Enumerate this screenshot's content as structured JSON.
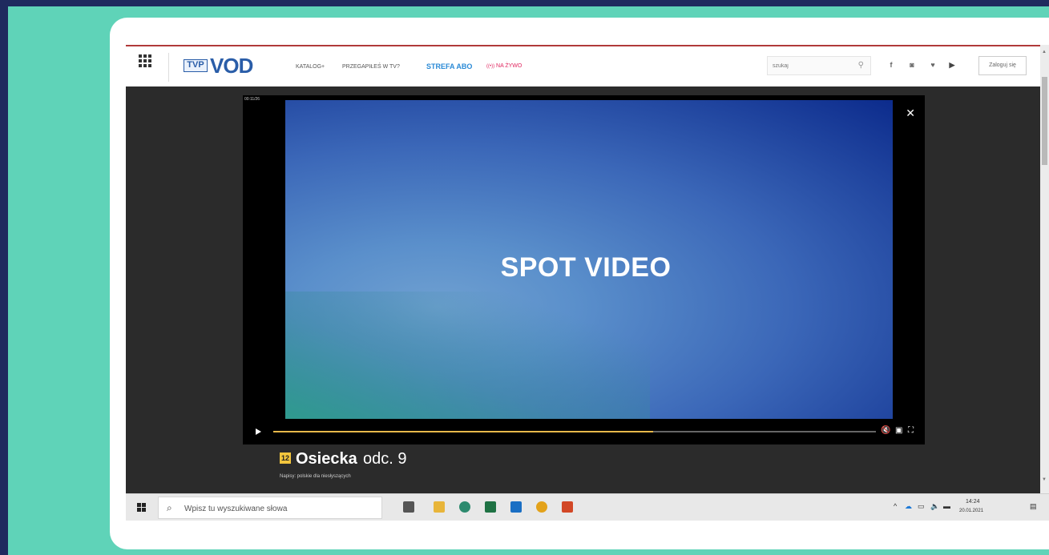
{
  "colors": {
    "background": "#1f2a5e",
    "frame": "#5fd3b8",
    "accent_blue": "#2a5da8",
    "live_red": "#e0245e",
    "progress": "#e6b84a"
  },
  "header": {
    "logo_tvp": "TVP",
    "logo_vod": "VOD",
    "nav": {
      "katalog": "KATALOG+",
      "przegapiles": "PRZEGAPIŁEŚ W TV?",
      "strefa": "STREFA ABO",
      "live": "NA ŻYWO"
    },
    "search_placeholder": "szukaj",
    "login_label": "Zaloguj się",
    "social_icons": [
      "facebook-icon",
      "instagram-icon",
      "twitter-icon",
      "youtube-icon"
    ]
  },
  "player": {
    "ad_timer": "00:11/26",
    "title": "SPOT VIDEO",
    "progress": 0.63
  },
  "show": {
    "age_rating": "12",
    "title": "Osiecka",
    "episode": "odc. 9",
    "subtitles": "Napisy: polskie dla niesłyszących"
  },
  "taskbar": {
    "search_placeholder": "Wpisz tu wyszukiwane słowa",
    "time": "14:24",
    "date": "20.01.2021"
  }
}
